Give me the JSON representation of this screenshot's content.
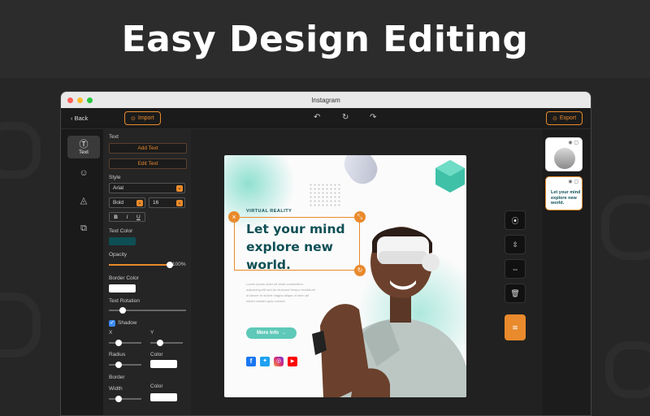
{
  "hero": {
    "title": "Easy Design Editing"
  },
  "window": {
    "title": "Instagram"
  },
  "toolbar": {
    "back": "Back",
    "import": "Import",
    "export": "Export"
  },
  "sidebar": {
    "items": [
      {
        "label": "Text",
        "icon": "text-icon"
      },
      {
        "label": "",
        "icon": "sticker-icon"
      },
      {
        "label": "",
        "icon": "shapes-icon"
      },
      {
        "label": "",
        "icon": "copy-icon"
      }
    ]
  },
  "panel": {
    "text_label": "Text",
    "add_text": "Add Text",
    "edit_text": "Edit Text",
    "style_label": "Style",
    "font": "Arial",
    "weight": "Bold",
    "size": "16",
    "fmt_b": "B",
    "fmt_i": "I",
    "fmt_u": "U",
    "text_color_label": "Text Color",
    "text_color": "#0e4f55",
    "opacity_label": "Opacity",
    "opacity_value": "100%",
    "opacity": 1.0,
    "border_color_label": "Border Color",
    "rotation_label": "Text Rotation",
    "rotation": 0.18,
    "shadow_label": "Shadow",
    "shadow_checked": true,
    "x_label": "X",
    "y_label": "Y",
    "shadow_x": 0.3,
    "shadow_y": 0.3,
    "radius_label": "Radius",
    "color_label": "Color",
    "radius": 0.3,
    "border_label": "Border",
    "width_label": "Width",
    "width": 0.3,
    "border_color_label2": "Color"
  },
  "post": {
    "tag": "VIRTUAL REALITY",
    "headline1": "Let your mind",
    "headline2": "explore new",
    "headline3": "world.",
    "body": "Lorem ipsum dolor sit amet consectetur adipiscing elit sed do eiusmod tempor incididunt ut labore et dolore magna aliqua ut enim ad minim veniam quis nostrud",
    "cta": "More Info",
    "accent": "#5ec9b8",
    "dark": "#0e4f55"
  },
  "thumbs": [
    {
      "kind": "photo"
    },
    {
      "kind": "text",
      "t1": "Let your mind",
      "t2": "explore new",
      "t3": "world."
    }
  ],
  "colors": {
    "accent": "#e98a2c"
  }
}
